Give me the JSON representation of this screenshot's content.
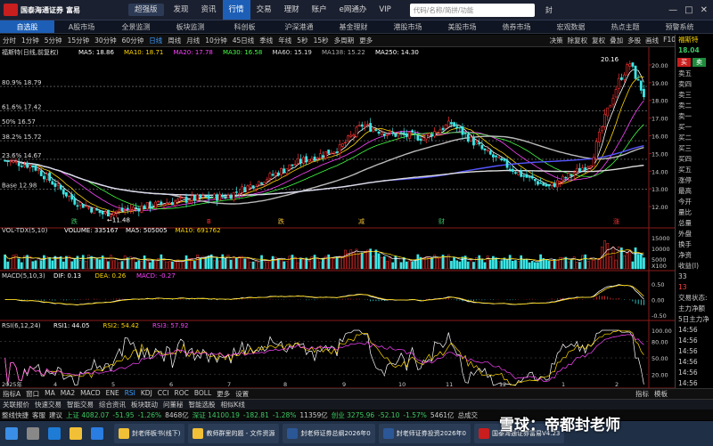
{
  "menubar": {
    "brand_cn": "国泰海通证券",
    "brand_app": "富易",
    "edition": "超强版",
    "items": [
      "发现",
      "资讯",
      "行情",
      "交易",
      "理财",
      "账户",
      "e网通办",
      "VIP"
    ],
    "active_index": 2,
    "search_placeholder": "代码/名称/简拼/功能",
    "user": "封"
  },
  "tabs": {
    "items": [
      "自选股",
      "A股市场",
      "全景监测",
      "板块监测",
      "科创板",
      "沪深港通",
      "基金理财",
      "港股市场",
      "美股市场",
      "债券市场",
      "宏观数据",
      "热点主题",
      "预警系统"
    ],
    "active_index": 0
  },
  "periods": {
    "items": [
      "分时",
      "1分钟",
      "5分钟",
      "15分钟",
      "30分钟",
      "60分钟",
      "日线",
      "周线",
      "月线",
      "10分钟",
      "45日线",
      "季线",
      "年线",
      "5秒",
      "15秒",
      "多周期",
      "更多"
    ],
    "active_index": 6
  },
  "chart_tools": [
    "决策",
    "除复权",
    "复权",
    "叠加",
    "多股",
    "画线",
    "F10",
    "标记",
    "设置"
  ],
  "stock": {
    "name": "福斯特",
    "price": "18.04",
    "change_prefix": "-0."
  },
  "main_chart": {
    "title": "福斯特(日线,前复权)",
    "ma": [
      {
        "label": "MA5: 18.86",
        "color": "#ffffff"
      },
      {
        "label": "MA10: 18.71",
        "color": "#ffd700"
      },
      {
        "label": "MA20: 17.78",
        "color": "#ff44ff"
      },
      {
        "label": "MA30: 16.58",
        "color": "#44ff44"
      },
      {
        "label": "MA60: 15.19",
        "color": "#dddddd"
      },
      {
        "label": "MA138: 15.22",
        "color": "#aaaaaa"
      },
      {
        "label": "MA250: 14.30",
        "color": "#ffffff"
      }
    ],
    "fib_levels": [
      {
        "label": "80.9% 18.79",
        "price": 18.79
      },
      {
        "label": "61.6% 17.42",
        "price": 17.42
      },
      {
        "label": "50% 16.57",
        "price": 16.57
      },
      {
        "label": "38.2% 15.72",
        "price": 15.72
      },
      {
        "label": "23.6% 14.67",
        "price": 14.67
      },
      {
        "label": "Base 12.98",
        "price": 12.98
      }
    ],
    "high_label": "20.16",
    "low_label": "←11.48",
    "y_ticks": [
      "20.00",
      "19.00",
      "18.00",
      "17.00",
      "16.00",
      "15.00",
      "14.00",
      "13.00",
      "12.00"
    ],
    "markers": [
      "跌",
      "B",
      "跌",
      "减",
      "财",
      "涨"
    ]
  },
  "volume_panel": {
    "title": "VOL-TDX(5,10)",
    "items": [
      {
        "label": "VOLUME: 335167",
        "color": "#ffffff"
      },
      {
        "label": "MA5: 505005",
        "color": "#ffffff"
      },
      {
        "label": "MA10: 691762",
        "color": "#ffd700"
      }
    ],
    "y_ticks": [
      "15000",
      "10000",
      "5000",
      "X100"
    ]
  },
  "macd_panel": {
    "title": "MACD(5,10,3)",
    "items": [
      {
        "label": "DIF: 0.13",
        "color": "#ffffff"
      },
      {
        "label": "DEA: 0.26",
        "color": "#ffd700"
      },
      {
        "label": "MACD: -0.27",
        "color": "#ff44ff"
      }
    ],
    "y_ticks": [
      "0.50",
      "0.00",
      "-0.50"
    ]
  },
  "rsi_panel": {
    "title": "RSI(6,12,24)",
    "items": [
      {
        "label": "RSI1: 44.05",
        "color": "#ffffff"
      },
      {
        "label": "RSI2: 54.42",
        "color": "#ffd700"
      },
      {
        "label": "RSI3: 57.92",
        "color": "#ff44ff"
      }
    ],
    "y_ticks": [
      "100.00",
      "80.00",
      "50.00",
      "20.00"
    ]
  },
  "x_axis": [
    "2025年",
    "4",
    "5",
    "6",
    "7",
    "8",
    "9",
    "10",
    "11",
    "12",
    "1",
    "2"
  ],
  "right_panel": {
    "title": "福斯特",
    "price": "18.04",
    "buttons": [
      "买",
      "卖"
    ],
    "order_rows": [
      "卖五",
      "卖四",
      "卖三",
      "卖二",
      "卖一",
      "买一",
      "买二",
      "买三",
      "买四",
      "买五"
    ],
    "stat_rows": [
      "涨停",
      "最高",
      "今开",
      "量比",
      "总量",
      "外盘",
      "换手",
      "净资",
      "收益(I)"
    ],
    "side_nums": [
      "33",
      "13"
    ],
    "info_rows": [
      "交易状态:",
      "主力净额",
      "5日主力净"
    ],
    "time_rows": [
      "14:56",
      "14:56",
      "14:56",
      "14:56",
      "14:56",
      "14:56",
      "14:56",
      "14:56",
      "14:56",
      "14:56",
      "14:56",
      "14:56"
    ]
  },
  "bottom_tabs": {
    "items": [
      "指标A",
      "窗口",
      "MA",
      "MA2",
      "MACD",
      "ENE",
      "RSI",
      "KDJ",
      "CCI",
      "ROC",
      "BOLL",
      "更多",
      "设置"
    ],
    "active_index": 6,
    "right": [
      "指标",
      "模板"
    ]
  },
  "status_bar": {
    "items": [
      "关联报价",
      "快速交易",
      "智能交易",
      "综合资讯",
      "板块联动",
      "问董秘",
      "智能选股",
      "相似K线"
    ]
  },
  "ticker": {
    "items": [
      {
        "text": "整线快捷",
        "cls": ""
      },
      {
        "text": "客服",
        "cls": ""
      },
      {
        "text": "建议",
        "cls": ""
      },
      {
        "text": "上证 4082.07",
        "cls": "down"
      },
      {
        "text": "-51.95",
        "cls": "down"
      },
      {
        "text": "-1.26%",
        "cls": "down"
      },
      {
        "text": "8468亿",
        "cls": ""
      },
      {
        "text": "深证 14100.19",
        "cls": "down"
      },
      {
        "text": "-182.81",
        "cls": "down"
      },
      {
        "text": "-1.28%",
        "cls": "down"
      },
      {
        "text": "11359亿",
        "cls": ""
      },
      {
        "text": "创业 3275.96",
        "cls": "down"
      },
      {
        "text": "-52.10",
        "cls": "down"
      },
      {
        "text": "-1.57%",
        "cls": "down"
      },
      {
        "text": "5461亿",
        "cls": ""
      },
      {
        "text": "总成交",
        "cls": ""
      }
    ]
  },
  "taskbar": {
    "items": [
      "封老师板书(线下)",
      "教师群里的题 - 文件资源",
      "封老师证券总纲2026年0",
      "封老师证券投资2026年0",
      "国泰海通证券富易V4.23"
    ]
  },
  "watermark": "雪球：帝都封老师"
}
